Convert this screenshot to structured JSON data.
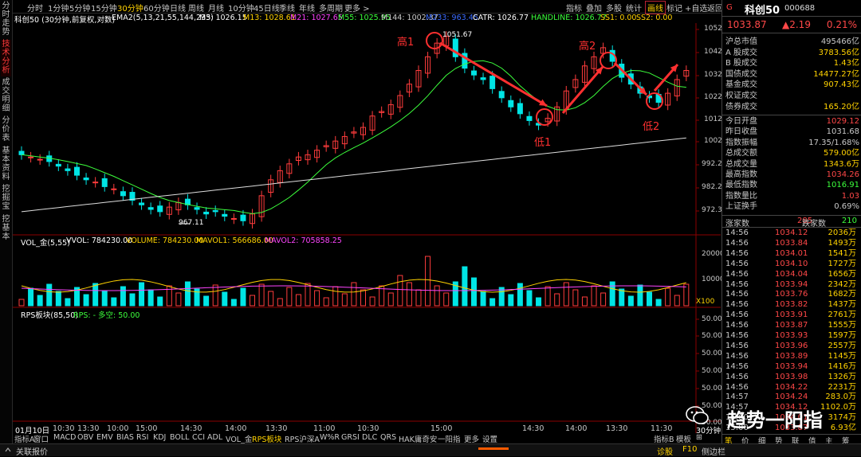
{
  "left_tabs": [
    "分时走势",
    "技术分析",
    "成交明细",
    "分价表",
    "基本资料",
    "挖掘宝",
    "挖基本"
  ],
  "period_bar": {
    "items": [
      "分时",
      "1分钟",
      "5分钟",
      "15分钟",
      "30分钟",
      "60分钟",
      "日线",
      "周线",
      "月线",
      "10分钟",
      "45日线",
      "季线",
      "年线",
      "多周期",
      "更多 >"
    ],
    "active_index": 4,
    "right_items": [
      "指标",
      "叠加",
      "多股",
      "统计",
      "画线",
      "标记",
      "+自选",
      "返回"
    ],
    "boxed_index": 4
  },
  "main_indicator": {
    "title": "科创50 (30分钟,前复权,对数)",
    "ema_label": "EMA2(5,13,21,55,144,233)",
    "m5": "M5: 1026.15",
    "m13": "M13: 1028.61",
    "m21": "M21: 1027.65",
    "m55": "M55: 1025.95",
    "m144": "M144: 1002.37",
    "m233": "M233: 963.45",
    "catr": "CATR: 1026.77",
    "handline": "HANDLINE: 1026.77",
    "ss1": "SS1: 0.00",
    "ss2": "SS2: 0.00"
  },
  "annotations": {
    "high1": "高1",
    "high2": "高2",
    "low1": "低1",
    "low2": "低2",
    "high_price": "1051.67",
    "low_price": "967.11"
  },
  "price_axis": [
    "1052",
    "1042",
    "1032",
    "1022",
    "1012",
    "1002",
    "992.2",
    "982.2",
    "972.3"
  ],
  "volume_indicator": {
    "title": "VOL_金(5,55)",
    "vvol": "VVOL: 784230.00",
    "volume": "VOLUME: 784230.00",
    "mavol1": "MAVOL1: 566686.00",
    "mavol2": "MAVOL2: 705858.25",
    "axis": [
      "20000",
      "10000",
      "X100"
    ]
  },
  "rps_indicator": {
    "title": "RPS板块(85,50)",
    "rps": "RPS: - 多空: 50.00",
    "axis": [
      "50.00",
      "50.00",
      "50.00",
      "50.00",
      "50.00",
      "50.00",
      "50.00"
    ]
  },
  "time_axis": [
    "01月10日",
    "10:30",
    "13:30",
    "10:00",
    "15:00",
    "14:30",
    "14:00",
    "13:30",
    "11:00",
    "10:30",
    "15:00",
    "14:30",
    "14:00",
    "13:30",
    "11:30",
    "30分钟"
  ],
  "bottom_tabs": [
    "指标A",
    "窗口",
    "MACD",
    "OBV",
    "EMV",
    "BIAS",
    "RSI",
    "KDJ",
    "BOLL",
    "CCI",
    "ADL",
    "VOL_金",
    "RPS板块",
    "RPS沪深A",
    "W%R",
    "GRSI",
    "DLC",
    "QRS",
    "HAK庸奇安",
    "一阳指",
    "更多",
    "设置"
  ],
  "bottom_right_tabs": [
    "指标B",
    "模板",
    "⊞"
  ],
  "quote_panel": {
    "g_badge": "G",
    "name": "科创50",
    "code": "000688",
    "price": "1033.87",
    "change": "▲2.19",
    "pct": "0.21%",
    "rows1": [
      {
        "label": "沪总市值",
        "value": "495466亿",
        "color": "#c8c8c8"
      },
      {
        "label": "A 股成交",
        "value": "3783.56亿",
        "color": "#ffd200"
      },
      {
        "label": "B 股成交",
        "value": "1.43亿",
        "color": "#ffd200"
      },
      {
        "label": "国债成交",
        "value": "14477.27亿",
        "color": "#ffd200"
      },
      {
        "label": "基金成交",
        "value": "907.43亿",
        "color": "#ffd200"
      },
      {
        "label": "权证成交",
        "value": "",
        "color": "#ffd200"
      },
      {
        "label": "债券成交",
        "value": "165.20亿",
        "color": "#ffd200"
      }
    ],
    "rows2": [
      {
        "label": "今日开盘",
        "value": "1029.12",
        "color": "#ff4848"
      },
      {
        "label": "昨日收盘",
        "value": "1031.68",
        "color": "#c8c8c8"
      },
      {
        "label": "指数振幅",
        "value": "17.35/1.68%",
        "color": "#c8c8c8"
      },
      {
        "label": "总成交额",
        "value": "579.00亿",
        "color": "#ffd200"
      },
      {
        "label": "总成交量",
        "value": "1343.6万",
        "color": "#ffd200"
      },
      {
        "label": "最高指数",
        "value": "1034.26",
        "color": "#ff4848"
      },
      {
        "label": "最低指数",
        "value": "1016.91",
        "color": "#3cff3c"
      },
      {
        "label": "指数量比",
        "value": "1.03",
        "color": "#ff4848"
      },
      {
        "label": "上证换手",
        "value": "0.69%",
        "color": "#c8c8c8"
      }
    ],
    "up_label": "涨家数",
    "up_count": "285",
    "down_label": "跌家数",
    "down_count": "210",
    "ticks": [
      {
        "t": "14:56",
        "p": "1034.12",
        "q": "2036万"
      },
      {
        "t": "14:56",
        "p": "1033.84",
        "q": "1493万"
      },
      {
        "t": "14:56",
        "p": "1034.01",
        "q": "1541万"
      },
      {
        "t": "14:56",
        "p": "1034.10",
        "q": "1727万"
      },
      {
        "t": "14:56",
        "p": "1034.04",
        "q": "1656万"
      },
      {
        "t": "14:56",
        "p": "1033.94",
        "q": "2342万"
      },
      {
        "t": "14:56",
        "p": "1033.76",
        "q": "1682万"
      },
      {
        "t": "14:56",
        "p": "1033.82",
        "q": "1437万"
      },
      {
        "t": "14:56",
        "p": "1033.91",
        "q": "2761万"
      },
      {
        "t": "14:56",
        "p": "1033.87",
        "q": "1555万"
      },
      {
        "t": "14:56",
        "p": "1033.93",
        "q": "1597万"
      },
      {
        "t": "14:56",
        "p": "1033.96",
        "q": "2557万"
      },
      {
        "t": "14:56",
        "p": "1033.89",
        "q": "1145万"
      },
      {
        "t": "14:56",
        "p": "1033.94",
        "q": "1416万"
      },
      {
        "t": "14:56",
        "p": "1033.98",
        "q": "1326万"
      },
      {
        "t": "14:56",
        "p": "1034.22",
        "q": "2231万"
      },
      {
        "t": "14:57",
        "p": "1034.24",
        "q": "283.0万"
      },
      {
        "t": "14:57",
        "p": "1034.12",
        "q": "1102.0万"
      },
      {
        "t": "15:00",
        "p": "1034.01",
        "q": "3174万"
      },
      {
        "t": "15:00",
        "p": "1033.87",
        "q": "6.93亿"
      }
    ],
    "bottom_tabs": [
      "笔",
      "价",
      "细",
      "势",
      "联",
      "值",
      "主",
      "筹"
    ]
  },
  "status_bar": {
    "left": "关联报价",
    "right_items": [
      "诊股",
      "F10",
      "侧边栏"
    ]
  },
  "watermark": "趋势一阳指",
  "colors": {
    "up": "#ff3c3c",
    "down": "#00e5e5",
    "accent": "#ffd200"
  }
}
